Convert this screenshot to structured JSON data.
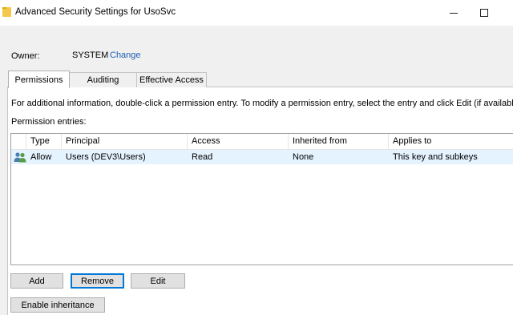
{
  "window": {
    "title": "Advanced Security Settings for UsoSvc",
    "folder_icon": "folder-icon",
    "minimize_icon": "minimize-icon",
    "maximize_icon": "maximize-icon"
  },
  "owner": {
    "label": "Owner:",
    "value": "SYSTEM",
    "change_link": "Change"
  },
  "tabs": [
    {
      "label": "Permissions",
      "active": true
    },
    {
      "label": "Auditing",
      "active": false
    },
    {
      "label": "Effective Access",
      "active": false
    }
  ],
  "permissions": {
    "info_text": "For additional information, double-click a permission entry. To modify a permission entry, select the entry and click Edit (if available).",
    "entries_label": "Permission entries:",
    "columns": [
      "Type",
      "Principal",
      "Access",
      "Inherited from",
      "Applies to"
    ],
    "rows": [
      {
        "icon": "users-group-icon",
        "type": "Allow",
        "principal": "Users (DEV3\\Users)",
        "access": "Read",
        "inherited_from": "None",
        "applies_to": "This key and subkeys"
      }
    ]
  },
  "buttons": {
    "add": "Add",
    "remove": "Remove",
    "edit": "Edit",
    "enable_inheritance": "Enable inheritance"
  },
  "colors": {
    "link": "#1a5fb4",
    "selected_row": "#e5f3ff",
    "focus_border": "#0078d7"
  }
}
